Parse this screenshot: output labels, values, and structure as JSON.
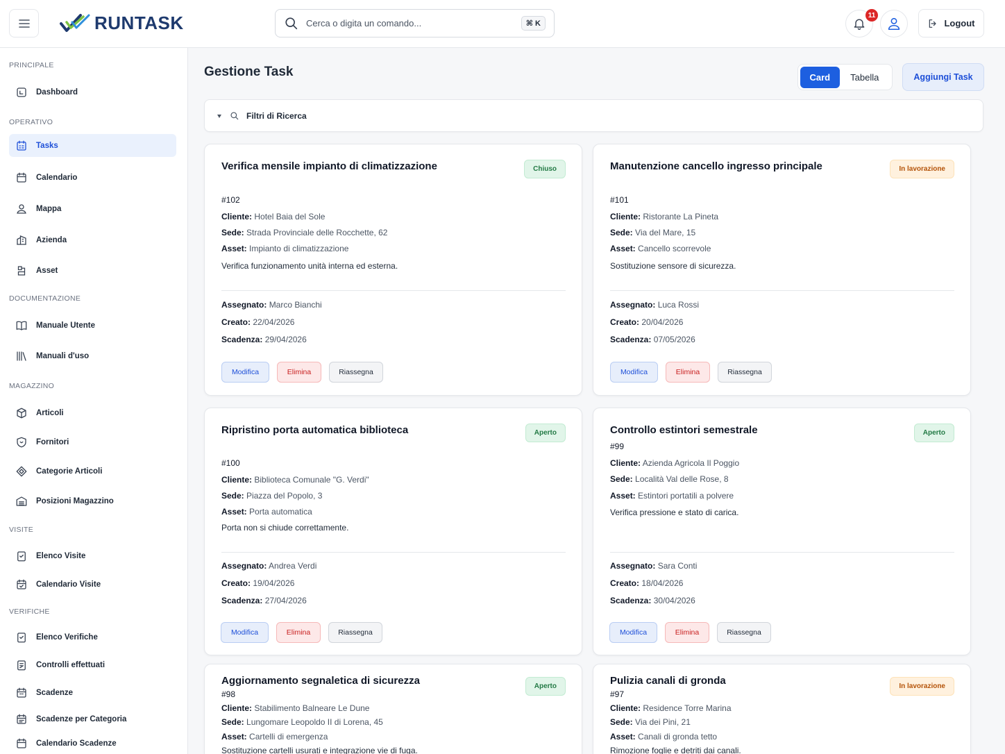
{
  "header": {
    "brand": "RUNTASK",
    "search_placeholder": "Cerca o digita un comando...",
    "shortcut": "⌘ K",
    "notifications_count": "11",
    "logout_label": "Logout"
  },
  "sidebar": {
    "sections": {
      "principale": "PRINCIPALE",
      "operativo": "OPERATIVO",
      "documentazione": "DOCUMENTAZIONE",
      "magazzino": "MAGAZZINO",
      "visite": "VISITE",
      "verifiche": "VERIFICHE"
    },
    "items": {
      "dashboard": "Dashboard",
      "tasks": "Tasks",
      "calendario": "Calendario",
      "mappa": "Mappa",
      "azienda": "Azienda",
      "asset": "Asset",
      "manuale_utente": "Manuale Utente",
      "manuali_uso": "Manuali d'uso",
      "articoli": "Articoli",
      "fornitori": "Fornitori",
      "categorie_articoli": "Categorie Articoli",
      "posizioni_magazzino": "Posizioni Magazzino",
      "elenco_visite": "Elenco Visite",
      "calendario_visite": "Calendario Visite",
      "elenco_verifiche": "Elenco Verifiche",
      "controlli_effettuati": "Controlli effettuati",
      "scadenze": "Scadenze",
      "scadenze_categoria": "Scadenze per Categoria",
      "calendario_scadenze": "Calendario Scadenze"
    }
  },
  "main": {
    "title": "Gestione Task",
    "view_card": "Card",
    "view_table": "Tabella",
    "add_task": "Aggiungi Task",
    "filters_label": "Filtri di Ricerca"
  },
  "labels": {
    "cliente": "Cliente:",
    "sede": "Sede:",
    "asset": "Asset:",
    "assegnato": "Assegnato:",
    "creato": "Creato:",
    "scadenza": "Scadenza:",
    "modifica": "Modifica",
    "elimina": "Elimina",
    "riassegna": "Riassegna"
  },
  "tasks": [
    {
      "title": "Verifica mensile impianto di climatizzazione",
      "status": "Chiuso",
      "number": "#102",
      "cliente": "Hotel Baia del Sole",
      "sede": "Strada Provinciale delle Rocchette, 62",
      "asset": "Impianto di climatizzazione",
      "description": "Verifica funzionamento unità interna ed esterna.",
      "assegnato": "Marco Bianchi",
      "creato": "22/04/2026",
      "scadenza": "29/04/2026"
    },
    {
      "title": "Manutenzione cancello ingresso principale",
      "status": "In lavorazione",
      "number": "#101",
      "cliente": "Ristorante La Pineta",
      "sede": "Via del Mare, 15",
      "asset": "Cancello scorrevole",
      "description": "Sostituzione sensore di sicurezza.",
      "assegnato": "Luca Rossi",
      "creato": "20/04/2026",
      "scadenza": "07/05/2026"
    },
    {
      "title": "Ripristino porta automatica biblioteca",
      "status": "Aperto",
      "number": "#100",
      "cliente": "Biblioteca Comunale \"G. Verdi\"",
      "sede": "Piazza del Popolo, 3",
      "asset": "Porta automatica",
      "description": "Porta non si chiude correttamente.",
      "assegnato": "Andrea Verdi",
      "creato": "19/04/2026",
      "scadenza": "27/04/2026"
    },
    {
      "title": "Controllo estintori semestrale",
      "status": "Aperto",
      "number": "#99",
      "cliente": "Azienda Agricola Il Poggio",
      "sede": "Località Val delle Rose, 8",
      "asset": "Estintori portatili a polvere",
      "description": "Verifica pressione e stato di carica.",
      "assegnato": "Sara Conti",
      "creato": "18/04/2026",
      "scadenza": "30/04/2026"
    },
    {
      "title": "Aggiornamento segnaletica di sicurezza",
      "status": "Aperto",
      "number": "#98",
      "cliente": "Stabilimento Balneare Le Dune",
      "sede": "Lungomare Leopoldo II di Lorena, 45",
      "asset": "Cartelli di emergenza",
      "description": "Sostituzione cartelli usurati e integrazione vie di fuga."
    },
    {
      "title": "Pulizia canali di gronda",
      "status": "In lavorazione",
      "number": "#97",
      "cliente": "Residence Torre Marina",
      "sede": "Via dei Pini, 21",
      "asset": "Canali di gronda tetto",
      "description": "Rimozione foglie e detriti dai canali."
    }
  ]
}
